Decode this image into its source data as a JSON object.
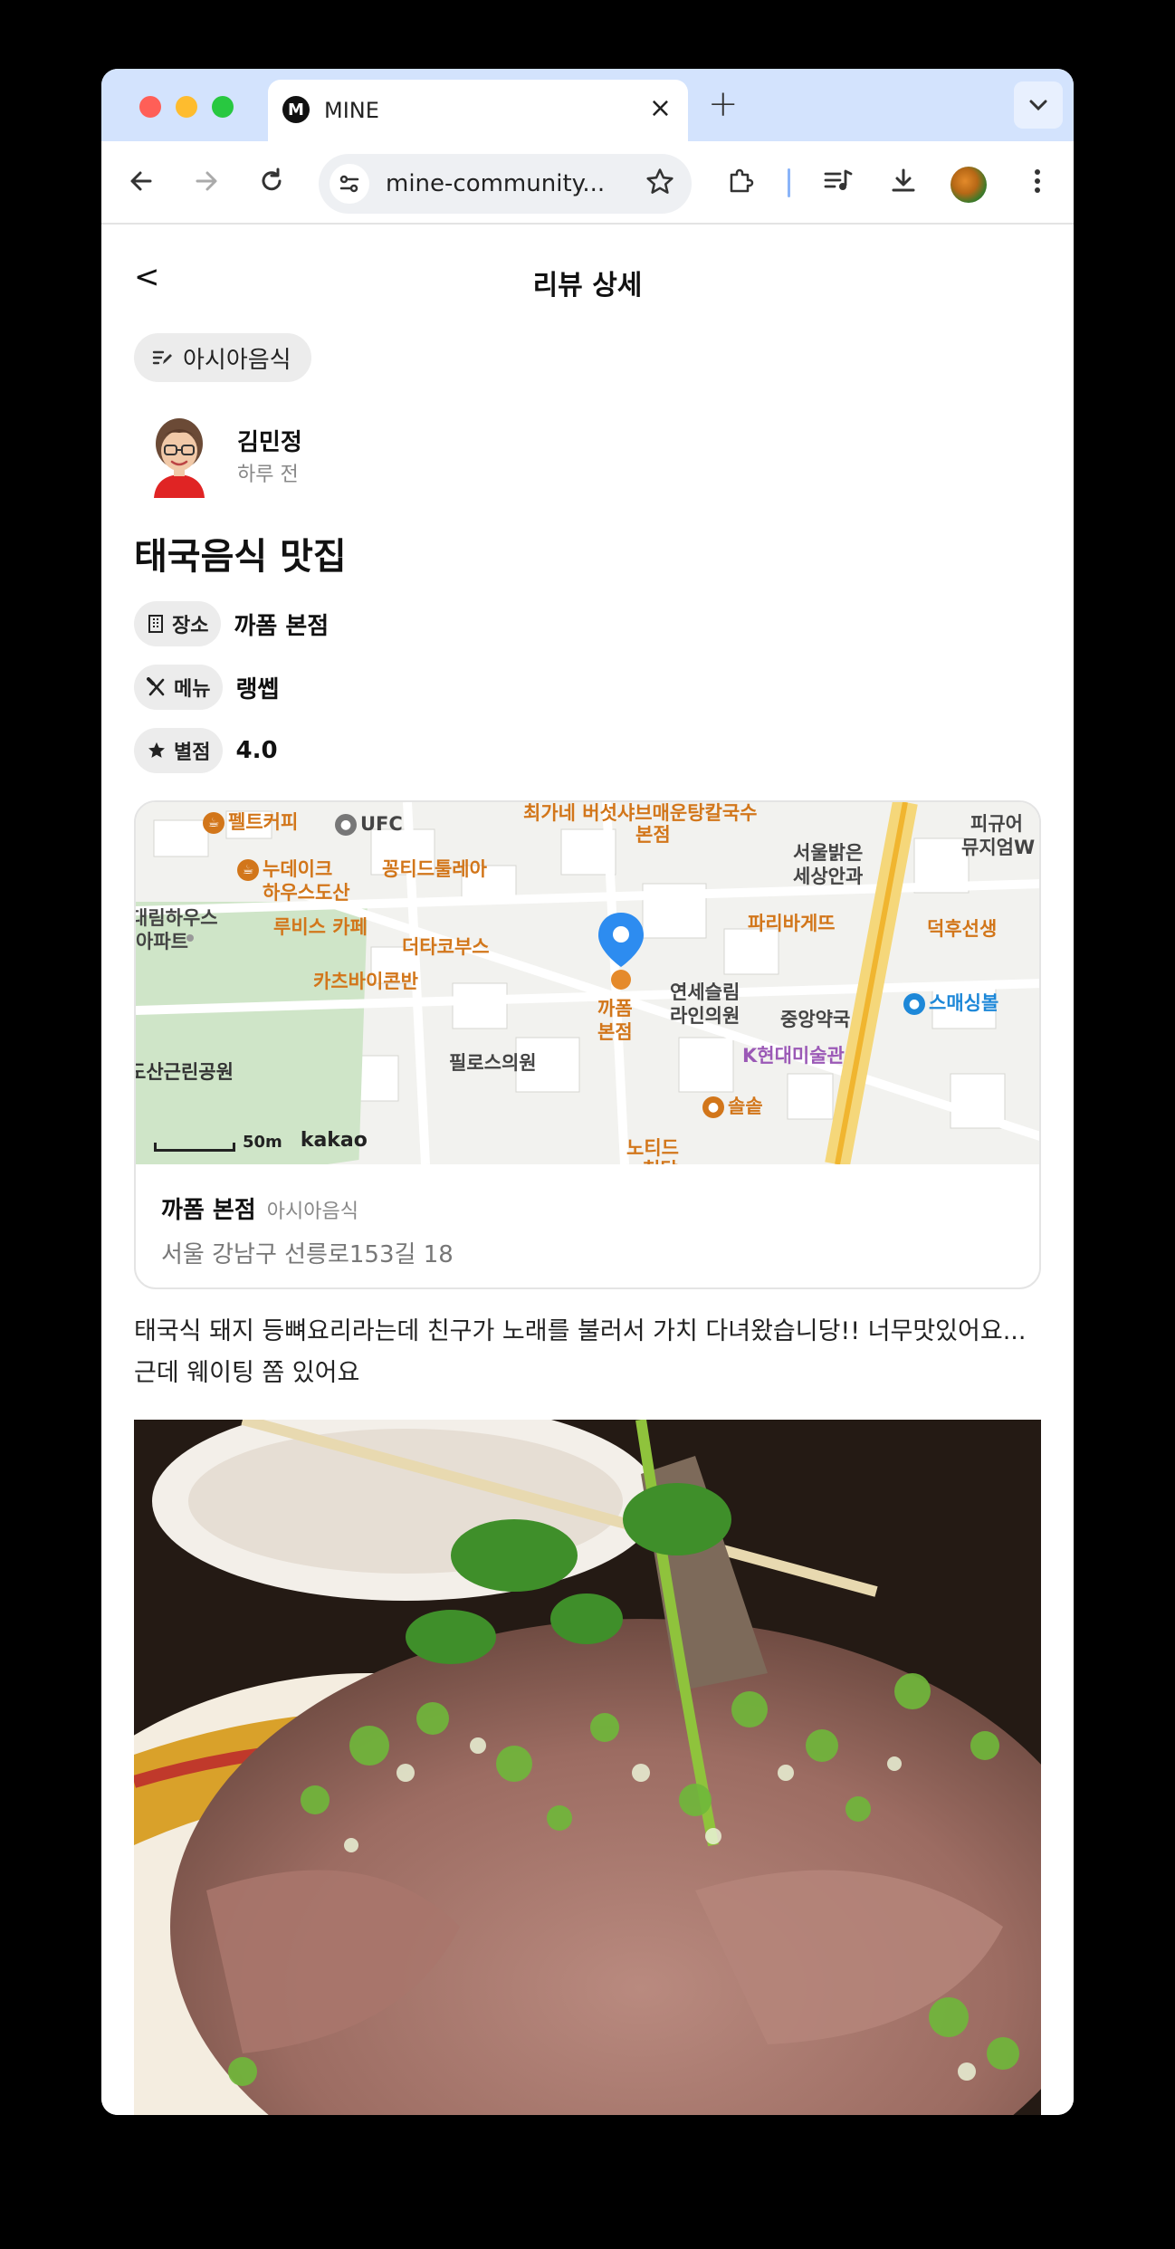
{
  "browser": {
    "tab_title": "MINE",
    "tab_favicon_letter": "M",
    "url": "mine-community..."
  },
  "page": {
    "back_label": "<",
    "title": "리뷰 상세",
    "category": "아시아음식",
    "author": {
      "name": "김민정",
      "time": "하루 전"
    },
    "post_title": "태국음식 맛집",
    "info": [
      {
        "label": "장소",
        "value": "까폼 본점",
        "icon": "building-icon"
      },
      {
        "label": "메뉴",
        "value": "랭쎕",
        "icon": "utensils-icon"
      },
      {
        "label": "별점",
        "value": "4.0",
        "icon": "star-icon"
      }
    ],
    "map": {
      "pois": [
        "펠트커피",
        "UFC",
        "최가네 버섯샤브매운탕칼국수",
        "본점",
        "피규어",
        "뮤지엄W",
        "누데이크",
        "하우스도산",
        "꽁티드툴레아",
        "서울밝은",
        "세상안과",
        "파리바게뜨",
        "덕후선생",
        "대림하우스",
        "아파트",
        "루비스 카페",
        "더타코부스",
        "까폼",
        "본점",
        "연세슬림",
        "라인의원",
        "중앙약국",
        "스매싱볼",
        "카츠바이콘반",
        "도산근린공원",
        "필로스의원",
        "K현대미술관",
        "솔솥",
        "노티드",
        "청담"
      ],
      "scale": "50m",
      "provider": "kakao"
    },
    "place": {
      "name": "까폼 본점",
      "category": "아시아음식",
      "address": "서울 강남구 선릉로153길 18"
    },
    "review_text": "태국식 돼지 등뼈요리라는데 친구가 노래를 불러서 가치 다녀왔습니당!! 너무맛있어요... 근데 웨이팅 쫌 있어요"
  }
}
